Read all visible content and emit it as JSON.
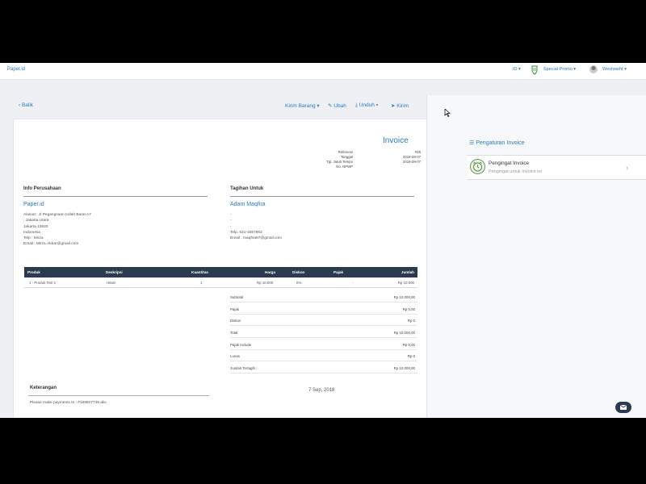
{
  "topbar": {
    "logo": "Paper.id",
    "lang": "ID ▾",
    "promo": "Special Promo ▾",
    "user": "Weshwehf ▾"
  },
  "actions": {
    "back": "‹ Balik",
    "kirim_barang": "Kirim Barang ▾",
    "ubah": "Ubah",
    "unduh": "Unduh ▾",
    "kirim": "Kirim"
  },
  "invoice": {
    "title": "Invoice",
    "meta_labels": [
      "Referensi",
      "Tanggal",
      "Tgl. Jatuh Tempo",
      "No. NPWP"
    ],
    "meta_values": [
      "#46",
      "2018-09-07",
      "2018-09-07",
      ""
    ],
    "company_header": "Info Perusahaan",
    "company_name": "Paper.id",
    "company_address": [
      "Alamat : Jl Pegangsaan Indah Barat A7",
      ", Jakarta Utara",
      "Jakarta 13920",
      "Indonesia",
      "Telp : Mirza",
      "Email : Mirza.Akbar@gmail.com"
    ],
    "bill_header": "Tagihan Untuk",
    "bill_name": "Adam Maqfira",
    "bill_address": [
      "-",
      "-",
      "-",
      "",
      "Telp. 021-4557862",
      "Email : maqfira97@gmail.com"
    ],
    "table_headers": [
      "Produk",
      "Deskripsi",
      "Kuantitas",
      "Harga",
      "Diskon",
      "Pajak",
      "Jumlah"
    ],
    "rows": [
      [
        "1 - Produk Test 1",
        "Hitam",
        "1",
        "Rp 10.000",
        "0%",
        "-",
        "Rp 10.000"
      ]
    ],
    "totals": [
      {
        "label": "Subtotal",
        "value": "Rp 10.000,00"
      },
      {
        "label": "Pajak",
        "value": "Rp 0,00"
      },
      {
        "label": "Diskon",
        "value": "Rp 0"
      },
      {
        "label": "Total",
        "value": "Rp 10.000,00"
      },
      {
        "label": "Pajak Include",
        "value": "Rp 0,00"
      },
      {
        "label": "Lunas",
        "value": "Rp 0"
      },
      {
        "label": "Jumlah Tertagih :",
        "value": "Rp 10.000,00"
      }
    ],
    "notes_header": "Keterangan",
    "notes_text": "Please make payments to : #199827749 abc",
    "date_sign": "7 Sep, 2018"
  },
  "sidebar": {
    "settings_header": "Pengaturan Invoice",
    "reminder_title": "Pengingat Invoice",
    "reminder_sub": "Pengingat untuk Invoice ini"
  },
  "colors": {
    "accent": "#2a7bbd",
    "table_header": "#2b3a4f"
  }
}
